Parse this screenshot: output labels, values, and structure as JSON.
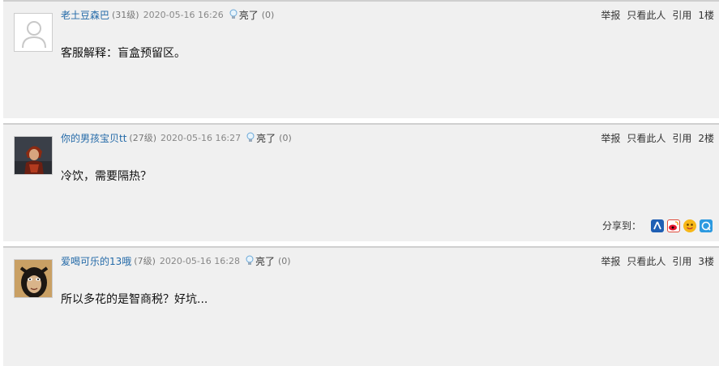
{
  "posts": [
    {
      "username": "老土豆森巴",
      "level": "(31级)",
      "time": "2020-05-16 16:26",
      "light_label": "亮了",
      "light_count": "(0)",
      "report": "举报",
      "only_this": "只看此人",
      "quote": "引用",
      "floor": "1楼",
      "content": "客服解释：盲盒预留区。",
      "avatar": "default-avatar-icon"
    },
    {
      "username": "你的男孩宝贝tt",
      "level": "(27级)",
      "time": "2020-05-16 16:27",
      "light_label": "亮了",
      "light_count": "(0)",
      "report": "举报",
      "only_this": "只看此人",
      "quote": "引用",
      "floor": "2楼",
      "content": "冷饮，需要隔热？",
      "avatar": "character-avatar",
      "share_label": "分享到：",
      "share_icons": [
        "renren-icon",
        "weibo-icon",
        "kaixin-icon",
        "qzone-icon"
      ]
    },
    {
      "username": "爱喝可乐的13哦",
      "level": "(7级)",
      "time": "2020-05-16 16:28",
      "light_label": "亮了",
      "light_count": "(0)",
      "report": "举报",
      "only_this": "只看此人",
      "quote": "引用",
      "floor": "3楼",
      "content": "所以多花的是智商税？好坑...",
      "avatar": "masked-face-avatar"
    }
  ],
  "colors": {
    "username": "#246aa8",
    "post_bg": "#f0f0f0",
    "separator": "#cfcfcf"
  }
}
